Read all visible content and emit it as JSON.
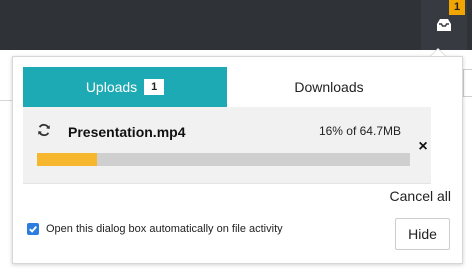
{
  "topbar": {
    "tray_icon": "upload-tray-icon",
    "badge": "1"
  },
  "dialog": {
    "tabs": [
      {
        "label": "Uploads",
        "badge": "1",
        "active": true
      },
      {
        "label": "Downloads",
        "active": false
      }
    ],
    "items": [
      {
        "icon": "refresh-icon",
        "filename": "Presentation.mp4",
        "status": "16% of 64.7MB",
        "progress": 0.16,
        "cancel_label": "×"
      }
    ],
    "cancel_all": "Cancel all",
    "auto_open_label": "Open this dialog box automatically on file activity",
    "auto_open_checked": true,
    "hide_label": "Hide"
  },
  "colors": {
    "accent": "#1eaab4",
    "progress_fill": "#f6b62e",
    "progress_track": "#cfcfcf",
    "badge": "#f0a500",
    "checkbox": "#2b7de0"
  }
}
